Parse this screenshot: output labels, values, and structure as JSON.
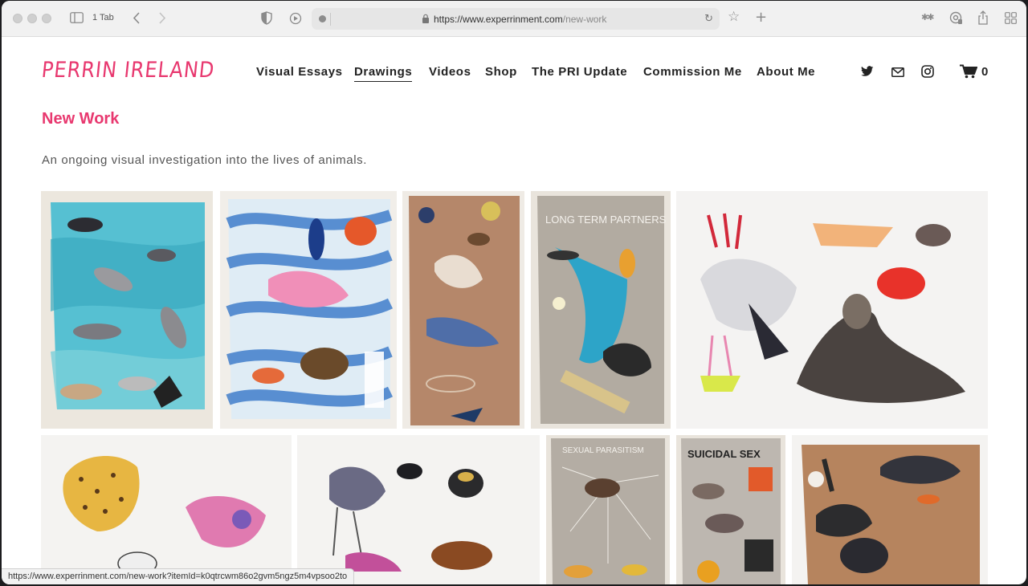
{
  "browser": {
    "tab_count_label": "1 Tab",
    "url_host": "https://www.experrinment.com",
    "url_path": "/new-work",
    "status_url": "https://www.experrinment.com/new-work?itemId=k0qtrcwm86o2gvm5ngz5m4vpsoo2to"
  },
  "site": {
    "logo_text": "PERRIN IRELAND",
    "nav": [
      "Visual Essays",
      "Drawings",
      "Videos",
      "Shop",
      "The PRI Update",
      "Commission Me",
      "About Me"
    ],
    "active_nav": "Drawings",
    "cart_count": "0",
    "accent_color": "#e8386f"
  },
  "page": {
    "title": "New Work",
    "description": "An ongoing visual investigation into the lives of animals."
  },
  "gallery": {
    "artwork_text": {
      "tile_4": "LONG TERM PARTNERS",
      "tile_8": "SEXUAL PARASITISM",
      "tile_9": "SUICIDAL SEX"
    }
  }
}
